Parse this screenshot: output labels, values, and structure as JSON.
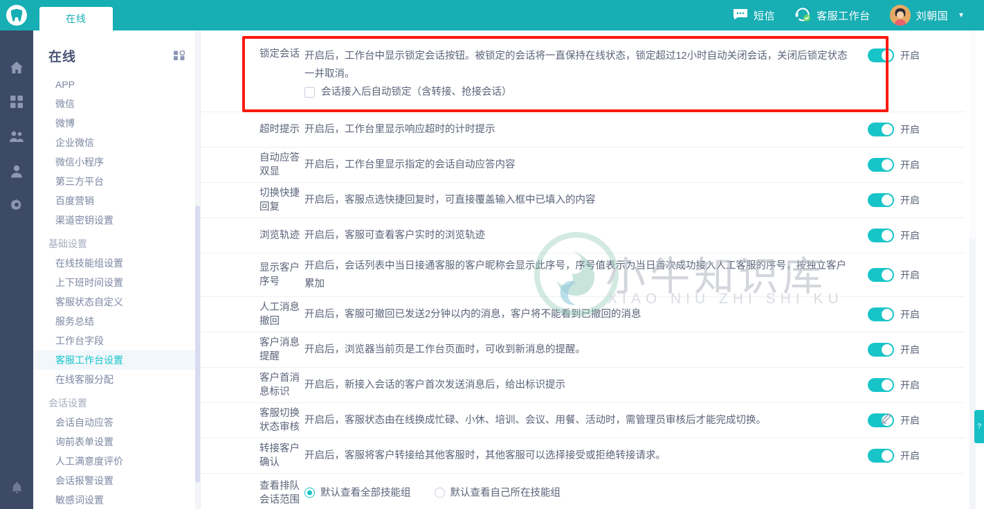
{
  "header": {
    "logo_icon": "tooth-logo-icon",
    "tabs": [
      {
        "label": "在线"
      }
    ],
    "right_items": [
      {
        "icon": "sms-icon",
        "label": "短信"
      },
      {
        "icon": "headset-icon",
        "label": "客服工作台"
      }
    ],
    "user": {
      "name": "刘朝国",
      "caret": "▼",
      "avatar_icon": "avatar"
    }
  },
  "rail": {
    "items": [
      {
        "icon": "home-icon"
      },
      {
        "icon": "grid-apps-icon"
      },
      {
        "icon": "users-icon"
      },
      {
        "icon": "user-icon"
      },
      {
        "icon": "gear-icon"
      }
    ],
    "bottom": {
      "icon": "bell-icon"
    }
  },
  "sidebar": {
    "title": "在线",
    "grid_icon": "grid-toggle-icon",
    "items": [
      {
        "label": "APP",
        "type": "item",
        "active": false
      },
      {
        "label": "微信",
        "type": "item",
        "active": false
      },
      {
        "label": "微博",
        "type": "item",
        "active": false
      },
      {
        "label": "企业微信",
        "type": "item",
        "active": false
      },
      {
        "label": "微信小程序",
        "type": "item",
        "active": false
      },
      {
        "label": "第三方平台",
        "type": "item",
        "active": false
      },
      {
        "label": "百度营销",
        "type": "item",
        "active": false
      },
      {
        "label": "渠道密钥设置",
        "type": "item",
        "active": false
      },
      {
        "label": "基础设置",
        "type": "group",
        "active": false
      },
      {
        "label": "在线技能组设置",
        "type": "item",
        "active": false
      },
      {
        "label": "上下班时间设置",
        "type": "item",
        "active": false
      },
      {
        "label": "客服状态自定义",
        "type": "item",
        "active": false
      },
      {
        "label": "服务总结",
        "type": "item",
        "active": false
      },
      {
        "label": "工作台字段",
        "type": "item",
        "active": false
      },
      {
        "label": "客服工作台设置",
        "type": "item",
        "active": true
      },
      {
        "label": "在线客服分配",
        "type": "item",
        "active": false
      },
      {
        "label": "会话设置",
        "type": "group",
        "active": false
      },
      {
        "label": "会话自动应答",
        "type": "item",
        "active": false
      },
      {
        "label": "询前表单设置",
        "type": "item",
        "active": false
      },
      {
        "label": "人工满意度评价",
        "type": "item",
        "active": false
      },
      {
        "label": "会话报警设置",
        "type": "item",
        "active": false
      },
      {
        "label": "敏感词设置",
        "type": "item",
        "active": false
      }
    ]
  },
  "settings": {
    "toggle_on_label": "开启",
    "rows": [
      {
        "name": "锁定会话",
        "desc": "开启后，工作台中显示锁定会话按钮。被锁定的会话将一直保持在线状态，锁定超过12小时自动关闭会话，关闭后锁定状态一并取消。",
        "toggle": "on",
        "toggle_label": "开启",
        "checkbox": {
          "label": "会话接入后自动锁定（含转接、抢接会话）",
          "checked": false
        },
        "highlighted": true
      },
      {
        "name": "超时提示",
        "desc": "开启后，工作台里显示响应超时的计时提示",
        "toggle": "on",
        "toggle_label": "开启"
      },
      {
        "name": "自动应答双显",
        "desc": "开启后，工作台里显示指定的会话自动应答内容",
        "toggle": "on",
        "toggle_label": "开启"
      },
      {
        "name": "切换快捷回复",
        "desc": "开启后，客服点选快捷回复时，可直接覆盖输入框中已填入的内容",
        "toggle": "on",
        "toggle_label": "开启"
      },
      {
        "name": "浏览轨迹",
        "desc": "开启后，客服可查看客户实时的浏览轨迹",
        "toggle": "on",
        "toggle_label": "开启"
      },
      {
        "name": "显示客户序号",
        "desc": "开启后，会话列表中当日接通客服的客户昵称会显示此序号，序号值表示为当日首次成功接入人工客服的序号，按独立客户累加",
        "toggle": "on",
        "toggle_label": "开启"
      },
      {
        "name": "人工消息撤回",
        "desc": "开启后，客服可撤回已发送2分钟以内的消息，客户将不能看到已撤回的消息",
        "toggle": "on",
        "toggle_label": "开启"
      },
      {
        "name": "客户消息提醒",
        "desc": "开启后，浏览器当前页是工作台页面时，可收到新消息的提醒。",
        "toggle": "on",
        "toggle_label": "开启"
      },
      {
        "name": "客户首消息标识",
        "desc": "开启后，新接入会话的客户首次发送消息后，给出标识提示",
        "toggle": "on",
        "toggle_label": "开启"
      },
      {
        "name": "客服切换状态审核",
        "desc": "开启后，客服状态由在线换成忙碌、小休、培训、会议、用餐、活动时，需管理员审核后才能完成切换。",
        "toggle": "on",
        "toggle_label": "开启",
        "edit_icon": "pencil-edit-icon"
      },
      {
        "name": "转接客户确认",
        "desc": "开启后，客服将客户转接给其他客服时，其他客服可以选择接受或拒绝转接请求。",
        "toggle": "on",
        "toggle_label": "开启"
      },
      {
        "name": "查看排队会话范围",
        "radios": [
          {
            "label": "默认查看全部技能组",
            "selected": true
          },
          {
            "label": "默认查看自己所在技能组",
            "selected": false
          }
        ]
      }
    ]
  },
  "watermark": {
    "text": "小牛知识库",
    "subtext": "XIAO NIU ZHI SHI KU"
  },
  "help_tab": {
    "label": "?"
  },
  "colors": {
    "header_teal": "#17aeb4",
    "accent_teal": "#17c5c9",
    "rail_navy": "#3c4a68",
    "highlight_red": "#fb1a0e",
    "text_gray": "#5b6379"
  }
}
